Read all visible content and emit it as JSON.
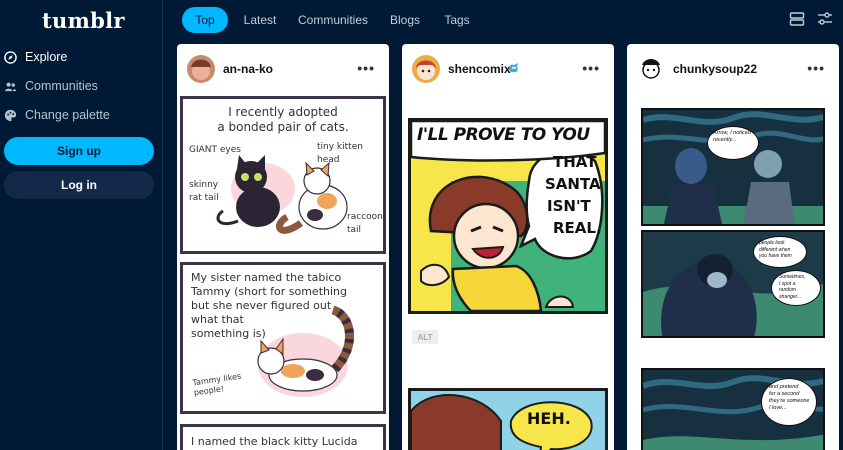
{
  "brand": {
    "logo": "tumblr"
  },
  "sidebar": {
    "items": [
      {
        "label": "Explore",
        "icon": "compass-icon"
      },
      {
        "label": "Communities",
        "icon": "people-icon"
      },
      {
        "label": "Change palette",
        "icon": "palette-icon"
      }
    ],
    "signup_label": "Sign up",
    "login_label": "Log in"
  },
  "tabs": [
    {
      "label": "Top",
      "active": true
    },
    {
      "label": "Latest"
    },
    {
      "label": "Communities"
    },
    {
      "label": "Blogs"
    },
    {
      "label": "Tags"
    }
  ],
  "toolbar": {
    "icons": [
      "layout-toggle-icon",
      "sliders-icon"
    ]
  },
  "posts": [
    {
      "username": "an-na-ko",
      "panels": {
        "p1_caption": [
          "I recently adopted",
          "a bonded pair of cats."
        ],
        "p1_labels": {
          "giant_eyes": "GIANT eyes",
          "tiny_head": "tiny kitten head",
          "skinny_tail": "skinny\nrat tail",
          "raccoon_tail": "raccoon\ntail"
        },
        "p2_text": [
          "My sister named the tabico",
          "Tammy (short for something",
          "but she never figured out",
          "what that",
          "something is)"
        ],
        "p2_label": "Tammy likes\npeople!",
        "p3_text": "I named the black kitty Lucida Sans"
      }
    },
    {
      "username": "shencomix",
      "badge": "verified-icon",
      "panels": {
        "p1_text": [
          "I'LL PROVE TO YOU",
          "THAT",
          "SANTA",
          "ISN'T",
          "REAL."
        ],
        "alt": "ALT",
        "p2_text": "HEH."
      }
    },
    {
      "username": "chunkysoup22",
      "panels": {
        "p1_bubble": [
          "Arrow, I noticed",
          "recently..."
        ],
        "p2_bubble1": [
          "people look",
          "different when",
          "you have them"
        ],
        "p2_bubble2": [
          "Sometimes,",
          "I spot a",
          "random",
          "stranger..."
        ],
        "p3_bubble": [
          "and pretend",
          "for a second",
          "they're someone",
          "I love..."
        ]
      }
    }
  ],
  "colors": {
    "background": "#001935",
    "accent": "#00b8ff",
    "card": "#ffffff"
  }
}
